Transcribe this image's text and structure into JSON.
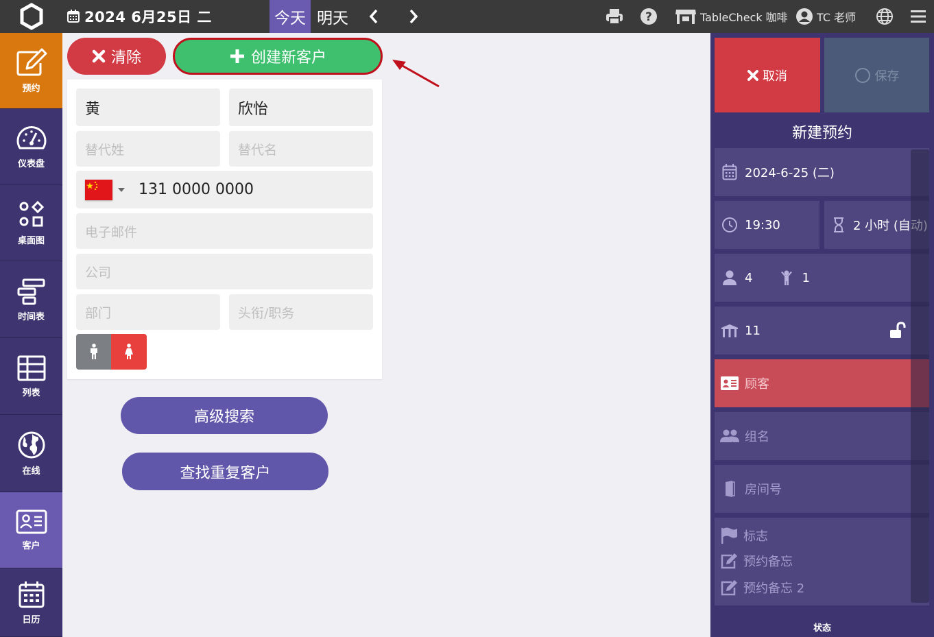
{
  "topbar": {
    "date": "2024 6月25日 二",
    "today": "今天",
    "tomorrow": "明天",
    "store": "TableCheck 咖啡",
    "user": "TC 老师"
  },
  "sidebar": {
    "items": [
      {
        "label": "预约",
        "icon": "edit-icon"
      },
      {
        "label": "仪表盘",
        "icon": "dashboard-icon"
      },
      {
        "label": "桌面图",
        "icon": "shapes-icon"
      },
      {
        "label": "时间表",
        "icon": "timeline-icon"
      },
      {
        "label": "列表",
        "icon": "table-icon"
      },
      {
        "label": "在线",
        "icon": "globe-icon"
      },
      {
        "label": "客户",
        "icon": "contact-card-icon"
      },
      {
        "label": "日历",
        "icon": "calendar-icon"
      }
    ]
  },
  "actions": {
    "clear": "清除",
    "create": "创建新客户"
  },
  "form": {
    "last_name": "黄",
    "first_name": "欣怡",
    "alt_last_placeholder": "替代姓",
    "alt_first_placeholder": "替代名",
    "phone": "131 0000 0000",
    "email_placeholder": "电子邮件",
    "company_placeholder": "公司",
    "department_placeholder": "部门",
    "title_placeholder": "头衔/职务"
  },
  "buttons": {
    "advanced_search": "高级搜索",
    "find_duplicates": "查找重复客户"
  },
  "panel": {
    "cancel": "取消",
    "save": "保存",
    "title": "新建预约",
    "date": "2024-6-25 (二)",
    "time": "19:30",
    "duration": "2 小时 (自动)",
    "adults": "4",
    "children": "1",
    "table": "11",
    "customer": "顾客",
    "group_name": "组名",
    "room_number": "房间号",
    "flag": "标志",
    "memo": "预约备忘",
    "memo2": "预约备忘 2",
    "status": "状态"
  },
  "colors": {
    "sidebar_bg": "#3e3570",
    "accent_orange": "#d9780e",
    "accent_purple": "#6a5bb0",
    "clear_red": "#d23a44",
    "create_green": "#3ec06f"
  }
}
